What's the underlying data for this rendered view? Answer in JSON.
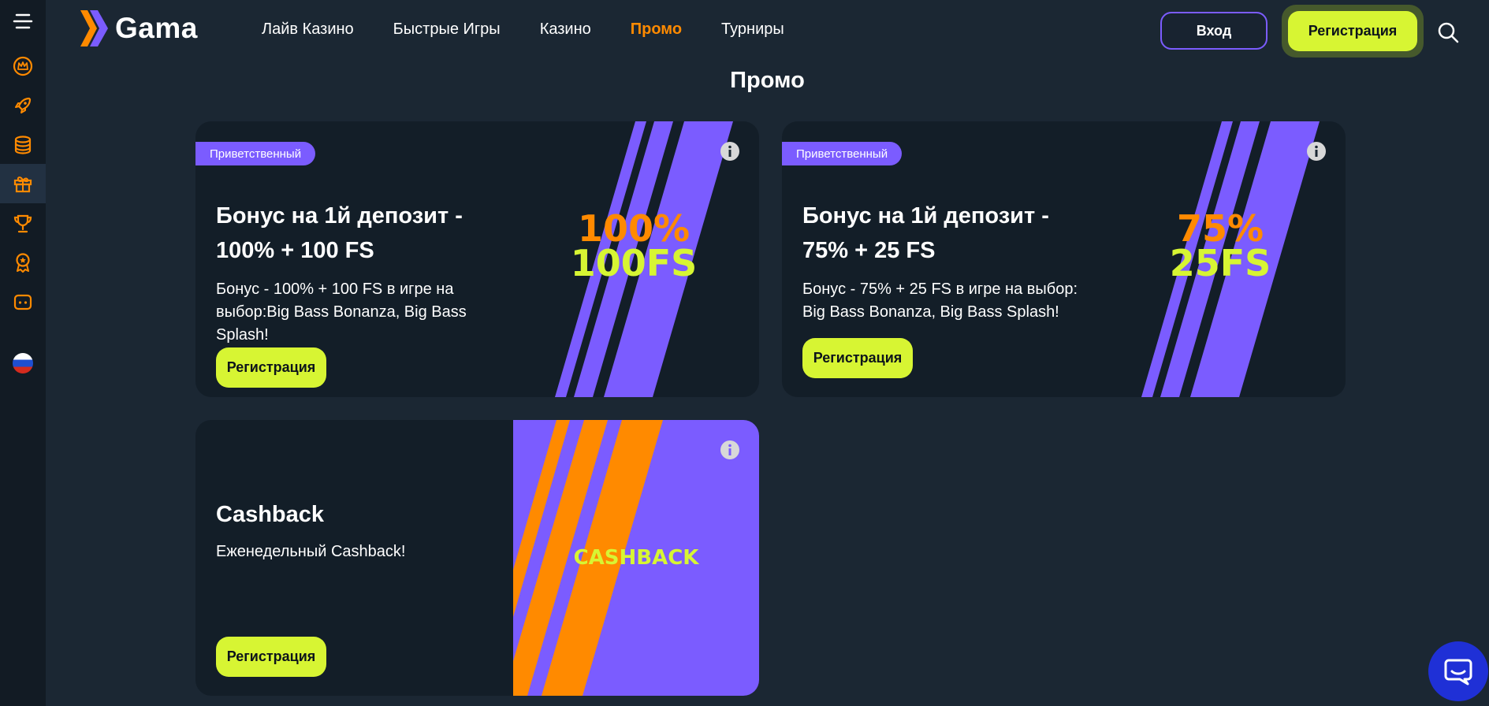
{
  "brand": {
    "name": "Gama",
    "accent": "#ff8a00",
    "purple": "#7b5cff",
    "lime": "#d7f533"
  },
  "sidebar": {
    "items": [
      {
        "icon": "menu-icon"
      },
      {
        "icon": "crown-icon"
      },
      {
        "icon": "rocket-icon"
      },
      {
        "icon": "coins-icon"
      },
      {
        "icon": "gift-icon",
        "active": true
      },
      {
        "icon": "trophy-icon"
      },
      {
        "icon": "award-icon"
      },
      {
        "icon": "chat-bubble-icon"
      },
      {
        "icon": "russia-flag-icon"
      }
    ]
  },
  "nav": {
    "items": [
      "Лайв Казино",
      "Быстрые Игры",
      "Казино",
      "Промо",
      "Турниры"
    ],
    "active": "Промо"
  },
  "header": {
    "login_label": "Вход",
    "register_label": "Регистрация"
  },
  "page": {
    "title": "Промо"
  },
  "promos": [
    {
      "badge": "Приветственный",
      "title_line1": "Бонус на 1й депозит -",
      "title_line2": "100% + 100 FS",
      "desc_lines": [
        "Бонус - 100% + 100 FS в игре на",
        "выбор:Big Bass Bonanza, Big Bass",
        "Splash!"
      ],
      "button": "Регистрация",
      "art_line1": "100%",
      "art_line2": "100FS"
    },
    {
      "badge": "Приветственный",
      "title_line1": "Бонус на 1й депозит -",
      "title_line2": "75% + 25 FS",
      "desc_lines": [
        "Бонус - 75% + 25 FS в игре на выбор:",
        "Big Bass Bonanza, Big Bass Splash!"
      ],
      "button": "Регистрация",
      "art_line1": "75%",
      "art_line2": "25FS"
    },
    {
      "title_line1": "Cashback",
      "desc_lines": [
        "Еженедельный Cashback!"
      ],
      "button": "Регистрация",
      "art_line1": "CASHBACK"
    }
  ]
}
